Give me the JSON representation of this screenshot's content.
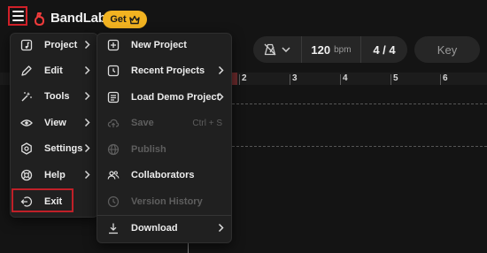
{
  "app": {
    "name": "BandLab"
  },
  "topbar": {
    "get_label": "Get"
  },
  "transport": {
    "bpm_value": "120",
    "bpm_unit": "bpm",
    "time_signature": "4 / 4",
    "key_label": "Key"
  },
  "ruler": {
    "ticks": [
      "2",
      "3",
      "4",
      "5",
      "6"
    ]
  },
  "main_menu": {
    "items": [
      {
        "label": "Project",
        "icon": "music-note-icon"
      },
      {
        "label": "Edit",
        "icon": "pencil-icon"
      },
      {
        "label": "Tools",
        "icon": "wand-icon"
      },
      {
        "label": "View",
        "icon": "eye-icon"
      },
      {
        "label": "Settings",
        "icon": "gear-icon"
      },
      {
        "label": "Help",
        "icon": "lifebuoy-icon"
      },
      {
        "label": "Exit",
        "icon": "exit-icon"
      }
    ]
  },
  "project_menu": {
    "items": [
      {
        "label": "New Project",
        "icon": "plus-square-icon"
      },
      {
        "label": "Recent Projects",
        "icon": "recent-icon"
      },
      {
        "label": "Load Demo Project",
        "icon": "demo-icon"
      },
      {
        "label": "Save",
        "shortcut": "Ctrl + S",
        "icon": "cloud-upload-icon",
        "disabled": true
      },
      {
        "label": "Publish",
        "icon": "globe-icon",
        "disabled": true
      },
      {
        "label": "Collaborators",
        "icon": "people-icon"
      },
      {
        "label": "Version History",
        "icon": "history-icon",
        "disabled": true
      },
      {
        "label": "Download",
        "icon": "download-icon"
      }
    ]
  },
  "colors": {
    "accent": "#f2b321",
    "highlight": "#c02028",
    "brand": "#f23c3c"
  }
}
